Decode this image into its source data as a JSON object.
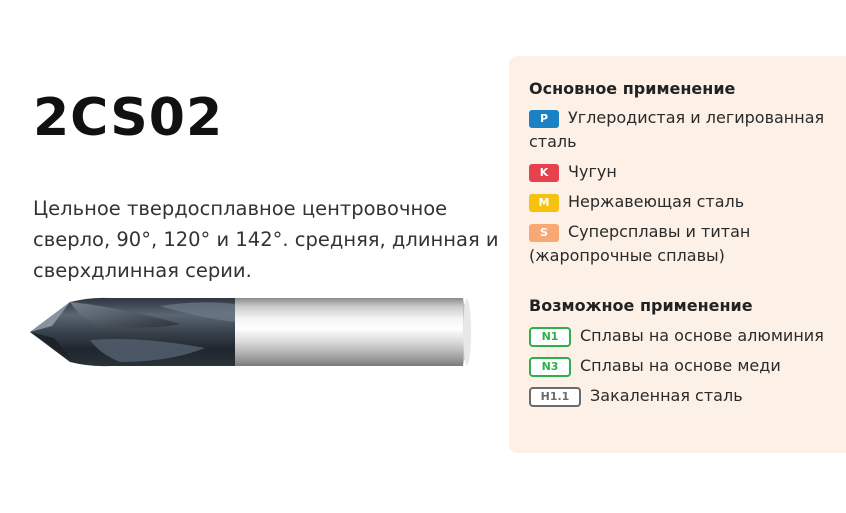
{
  "product": {
    "code": "2CS02",
    "description": "Цельное твердосплавное центровочное сверло, 90°, 120° и 142°. средняя, длинная и сверхдлинная серии."
  },
  "primary": {
    "title": "Основное применение",
    "items": [
      {
        "badge": "P",
        "text": "Углеродистая и легированная сталь",
        "color": "#1a82c4"
      },
      {
        "badge": "K",
        "text": "Чугун",
        "color": "#e8414e"
      },
      {
        "badge": "M",
        "text": "Нержавеющая сталь",
        "color": "#f7c20f"
      },
      {
        "badge": "S",
        "text": "Суперсплавы и титан (жаропрочные сплавы)",
        "color": "#f8a872"
      }
    ]
  },
  "secondary": {
    "title": "Возможное применение",
    "items": [
      {
        "badge": "N1",
        "text": "Сплавы на основе алюминия",
        "color": "#2fae49"
      },
      {
        "badge": "N3",
        "text": "Сплавы на основе меди",
        "color": "#2fae49"
      },
      {
        "badge": "H1.1",
        "text": "Закаленная сталь",
        "color": "#6b6b6b"
      }
    ]
  },
  "drill_image": {
    "icon": "center-drill-icon"
  }
}
